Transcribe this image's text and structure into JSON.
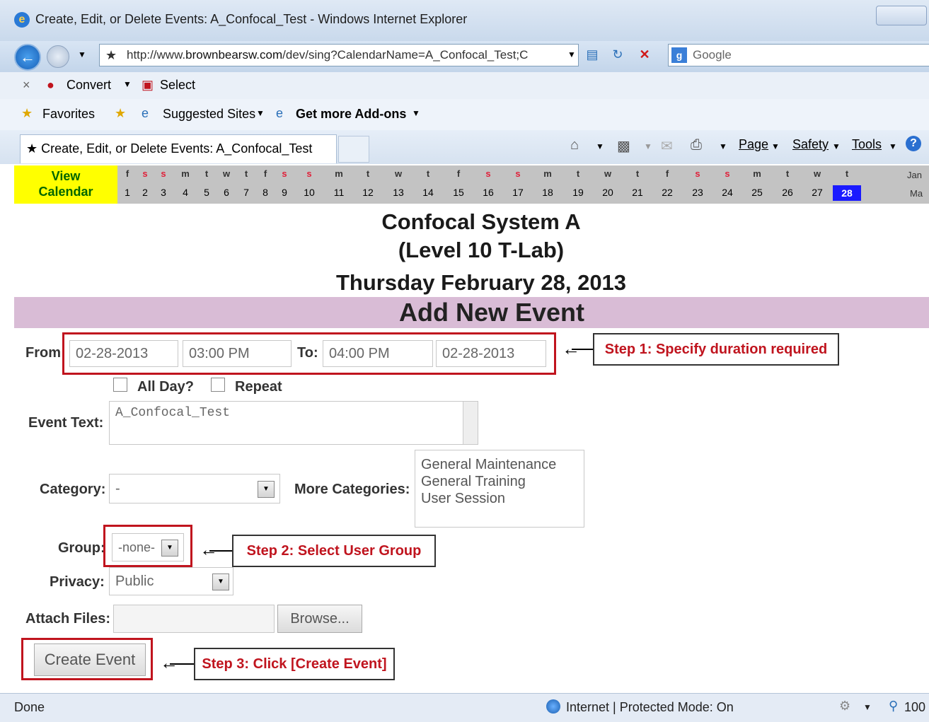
{
  "window": {
    "title": "Create, Edit, or Delete Events: A_Confocal_Test - Windows Internet Explorer"
  },
  "address": {
    "prefix": "http://www.",
    "domain": "brownbearsw.com",
    "path": "/dev/sing?CalendarName=A_Confocal_Test;C"
  },
  "search": {
    "placeholder": "Google"
  },
  "command_bar": {
    "convert": "Convert",
    "select": "Select"
  },
  "favorites_bar": {
    "favorites": "Favorites",
    "suggested": "Suggested Sites",
    "addons": "Get more Add-ons"
  },
  "tab": {
    "title": "Create, Edit, or Delete Events: A_Confocal_Test"
  },
  "toolbar": {
    "page": "Page",
    "safety": "Safety",
    "tools": "Tools"
  },
  "calendar_strip": {
    "view_label_1": "View",
    "view_label_2": "Calendar",
    "days": [
      {
        "l": "f",
        "n": "1",
        "we": false
      },
      {
        "l": "s",
        "n": "2",
        "we": true
      },
      {
        "l": "s",
        "n": "3",
        "we": true
      },
      {
        "l": "m",
        "n": "4",
        "we": false
      },
      {
        "l": "t",
        "n": "5",
        "we": false
      },
      {
        "l": "w",
        "n": "6",
        "we": false
      },
      {
        "l": "t",
        "n": "7",
        "we": false
      },
      {
        "l": "f",
        "n": "8",
        "we": false
      },
      {
        "l": "s",
        "n": "9",
        "we": true
      },
      {
        "l": "s",
        "n": "10",
        "we": true
      },
      {
        "l": "m",
        "n": "11",
        "we": false
      },
      {
        "l": "t",
        "n": "12",
        "we": false
      },
      {
        "l": "w",
        "n": "13",
        "we": false
      },
      {
        "l": "t",
        "n": "14",
        "we": false
      },
      {
        "l": "f",
        "n": "15",
        "we": false
      },
      {
        "l": "s",
        "n": "16",
        "we": true
      },
      {
        "l": "s",
        "n": "17",
        "we": true
      },
      {
        "l": "m",
        "n": "18",
        "we": false
      },
      {
        "l": "t",
        "n": "19",
        "we": false
      },
      {
        "l": "w",
        "n": "20",
        "we": false
      },
      {
        "l": "t",
        "n": "21",
        "we": false
      },
      {
        "l": "f",
        "n": "22",
        "we": false
      },
      {
        "l": "s",
        "n": "23",
        "we": true
      },
      {
        "l": "s",
        "n": "24",
        "we": true
      },
      {
        "l": "m",
        "n": "25",
        "we": false
      },
      {
        "l": "t",
        "n": "26",
        "we": false
      },
      {
        "l": "w",
        "n": "27",
        "we": false
      },
      {
        "l": "t",
        "n": "28",
        "we": false
      }
    ],
    "selected_day": "28",
    "next_month_1": "Jan",
    "next_month_2": "Ma"
  },
  "header": {
    "system": "Confocal System A",
    "location": "(Level 10 T-Lab)",
    "date": "Thursday February 28, 2013",
    "section": "Add New Event"
  },
  "form": {
    "from_label": "From",
    "from_date": "02-28-2013",
    "from_time": "03:00 PM",
    "to_label": "To:",
    "to_time": "04:00 PM",
    "to_date": "02-28-2013",
    "all_day": "All Day?",
    "repeat": "Repeat",
    "event_text_label": "Event Text:",
    "event_text": "A_Confocal_Test",
    "category_label": "Category:",
    "category_value": "-",
    "more_categories_label": "More Categories:",
    "more_categories": [
      "General Maintenance",
      "General Training",
      "User Session"
    ],
    "group_label": "Group:",
    "group_value": "-none-",
    "privacy_label": "Privacy:",
    "privacy_value": "Public",
    "attach_label": "Attach Files:",
    "browse": "Browse...",
    "create": "Create Event"
  },
  "callouts": {
    "step1": "Step 1: Specify duration required",
    "step2": "Step 2: Select User Group",
    "step3": "Step 3: Click [Create Event]"
  },
  "status": {
    "left": "Done",
    "zone": "Internet | Protected Mode: On",
    "zoom": "100"
  }
}
